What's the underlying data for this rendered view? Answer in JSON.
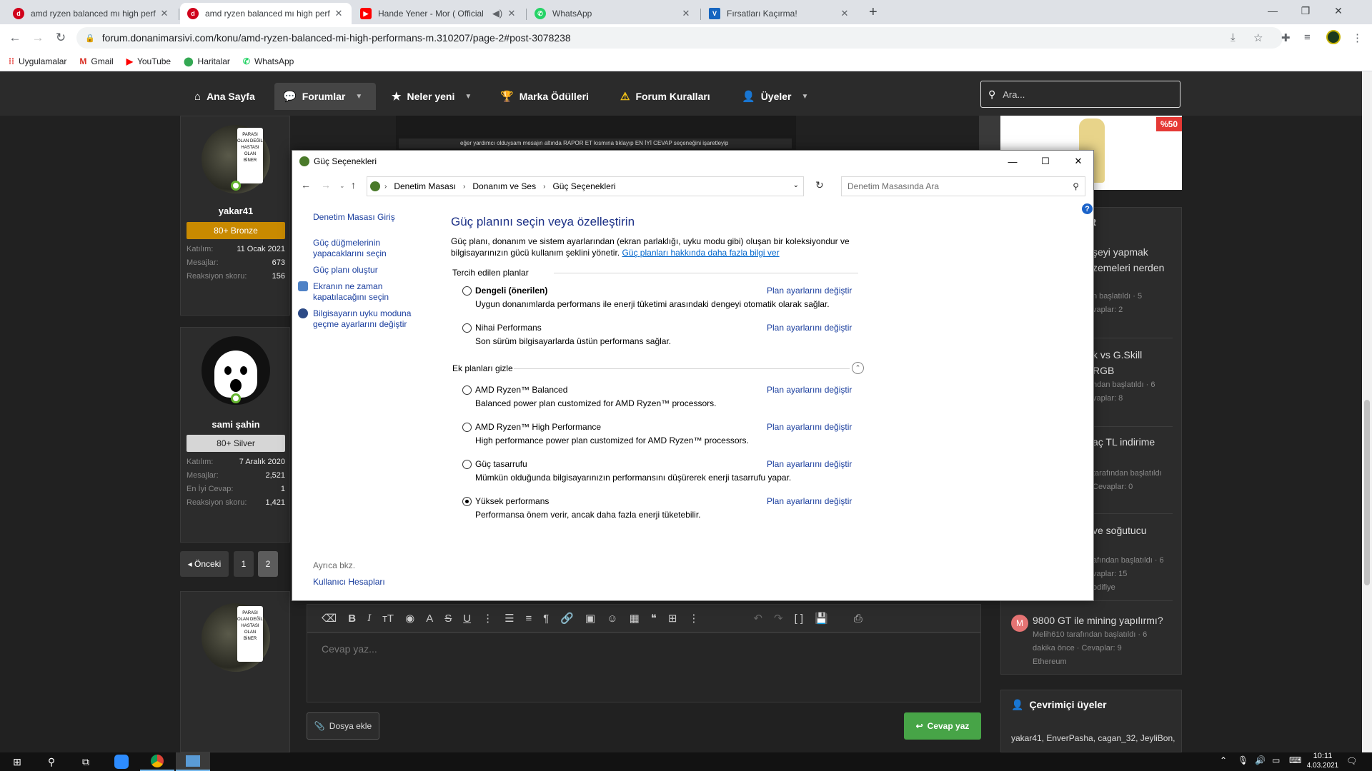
{
  "browser": {
    "tabs": [
      {
        "title": "amd ryzen balanced mı high perf",
        "favicon_color": "#d0021b",
        "active": false
      },
      {
        "title": "amd ryzen balanced mı high perf",
        "favicon_color": "#d0021b",
        "active": true
      },
      {
        "title": "Hande Yener - Mor ( Official",
        "favicon_color": "#ff0000",
        "active": false
      },
      {
        "title": "WhatsApp",
        "favicon_color": "#25d366",
        "active": false
      },
      {
        "title": "Fırsatları Kaçırma!",
        "favicon_color": "#1565c0",
        "active": false
      }
    ],
    "url": "forum.donanimarsivi.com/konu/amd-ryzen-balanced-mi-high-performans-m.310207/page-2#post-3078238",
    "bookmarks": [
      {
        "label": "Uygulamalar",
        "icon": "apps-grid-icon"
      },
      {
        "label": "Gmail",
        "icon": "gmail-icon"
      },
      {
        "label": "YouTube",
        "icon": "youtube-icon"
      },
      {
        "label": "Haritalar",
        "icon": "maps-icon"
      },
      {
        "label": "WhatsApp",
        "icon": "whatsapp-icon"
      }
    ]
  },
  "forum": {
    "nav": [
      {
        "label": "Ana Sayfa",
        "icon": "home-icon"
      },
      {
        "label": "Forumlar",
        "icon": "comments-icon"
      },
      {
        "label": "Neler yeni",
        "icon": "star-icon"
      },
      {
        "label": "Marka Ödülleri",
        "icon": "trophy-icon"
      },
      {
        "label": "Forum Kuralları",
        "icon": "warning-icon"
      },
      {
        "label": "Üyeler",
        "icon": "user-icon"
      }
    ],
    "search_placeholder": "Ara...",
    "avatar_sign_text": "PARASI OLAN DEĞİL HASTASI OLAN BİNER",
    "users": [
      {
        "name": "yakar41",
        "rank": "80+ Bronze",
        "rank_color": "#c98a00",
        "stats": [
          {
            "k": "Katılım:",
            "v": "11 Ocak 2021"
          },
          {
            "k": "Mesajlar:",
            "v": "673"
          },
          {
            "k": "Reaksiyon skoru:",
            "v": "156"
          }
        ]
      },
      {
        "name": "sami şahin",
        "rank": "80+ Silver",
        "rank_color": "#d6d6d6",
        "stats": [
          {
            "k": "Katılım:",
            "v": "7 Aralık 2020"
          },
          {
            "k": "Mesajlar:",
            "v": "2,521"
          },
          {
            "k": "En İyi Cevap:",
            "v": "1"
          },
          {
            "k": "Reaksiyon skoru:",
            "v": "1,421"
          }
        ]
      }
    ],
    "screenshot_caption": "eğer yardımcı olduysam mesajın altında RAPOR ET kısmına tıklayıp EN İYİ CEVAP seçeneğini işaretleyip",
    "pagination": {
      "prev": "◂ Önceki",
      "pages": [
        "1",
        "2"
      ],
      "current": "2"
    },
    "sidebar": {
      "ad_badge": "%50",
      "header_fragment": "R",
      "threads": [
        {
          "title_lines": [
            "şeyi yapmak",
            "zemeleri nerden"
          ],
          "meta_lines": [
            "n başlatıldı · 5",
            "vaplar: 2"
          ]
        },
        {
          "title_lines": [
            "k vs G.Skill",
            "RGB"
          ],
          "meta_lines": [
            "ndan başlatıldı · 6",
            "vaplar: 8"
          ]
        },
        {
          "title_lines": [
            "aç TL indirime"
          ],
          "meta_lines": [
            "tarafından başlatıldı",
            "Cevaplar: 0"
          ]
        },
        {
          "title_lines": [
            "ve soğutucu"
          ],
          "meta_lines": [
            "afından başlatıldı · 6",
            "vaplar: 15",
            "odifiye"
          ]
        },
        {
          "title_lines": [
            "9800 GT ile mining yapılırmı?"
          ],
          "meta_lines": [
            "Melih610 tarafından başlatıldı · 6",
            "dakika önce · Cevaplar: 9",
            "Ethereum"
          ],
          "avatar_letter": "M"
        }
      ],
      "online_title": "Çevrimiçi üyeler",
      "online_list": "yakar41, EnverPasha, cagan_32, JeyliBon,"
    },
    "editor": {
      "placeholder": "Cevap yaz...",
      "attach": "Dosya ekle",
      "submit": "Cevap yaz"
    }
  },
  "dialog": {
    "title": "Güç Seçenekleri",
    "breadcrumb": [
      "Denetim Masası",
      "Donanım ve Ses",
      "Güç Seçenekleri"
    ],
    "search_placeholder": "Denetim Masasında Ara",
    "left_links": [
      "Denetim Masası Giriş",
      "Güç düğmelerinin yapacaklarını seçin",
      "Güç planı oluştur",
      "Ekranın ne zaman kapatılacağını seçin",
      "Bilgisayarın uyku moduna geçme ayarlarını değiştir"
    ],
    "see_also": "Ayrıca bkz.",
    "see_also_link": "Kullanıcı Hesapları",
    "heading": "Güç planını seçin veya özelleştirin",
    "description": "Güç planı, donanım ve sistem ayarlarından (ekran parlaklığı, uyku modu gibi) oluşan bir koleksiyondur ve bilgisayarınızın gücü kullanım şeklini yönetir.",
    "description_link": "Güç planları hakkında daha fazla bilgi ver",
    "preferred_header": "Tercih edilen planlar",
    "extra_header": "Ek planları gizle",
    "change_link": "Plan ayarlarını değiştir",
    "preferred_plans": [
      {
        "name": "Dengeli (önerilen)",
        "desc": "Uygun donanımlarda performans ile enerji tüketimi arasındaki dengeyi otomatik olarak sağlar.",
        "selected": false,
        "bold": true
      },
      {
        "name": "Nihai Performans",
        "desc": "Son sürüm bilgisayarlarda üstün performans sağlar.",
        "selected": false,
        "bold": false
      }
    ],
    "extra_plans": [
      {
        "name": "AMD Ryzen™ Balanced",
        "desc": "Balanced power plan customized for AMD Ryzen™ processors.",
        "selected": false
      },
      {
        "name": "AMD Ryzen™ High Performance",
        "desc": "High performance power plan customized for AMD Ryzen™ processors.",
        "selected": false
      },
      {
        "name": "Güç tasarrufu",
        "desc": "Mümkün olduğunda bilgisayarınızın performansını düşürerek enerji tasarrufu yapar.",
        "selected": false
      },
      {
        "name": "Yüksek performans",
        "desc": "Performansa önem verir, ancak daha fazla enerji tüketebilir.",
        "selected": true
      }
    ]
  },
  "taskbar": {
    "time": "10:11",
    "date": "4.03.2021"
  }
}
